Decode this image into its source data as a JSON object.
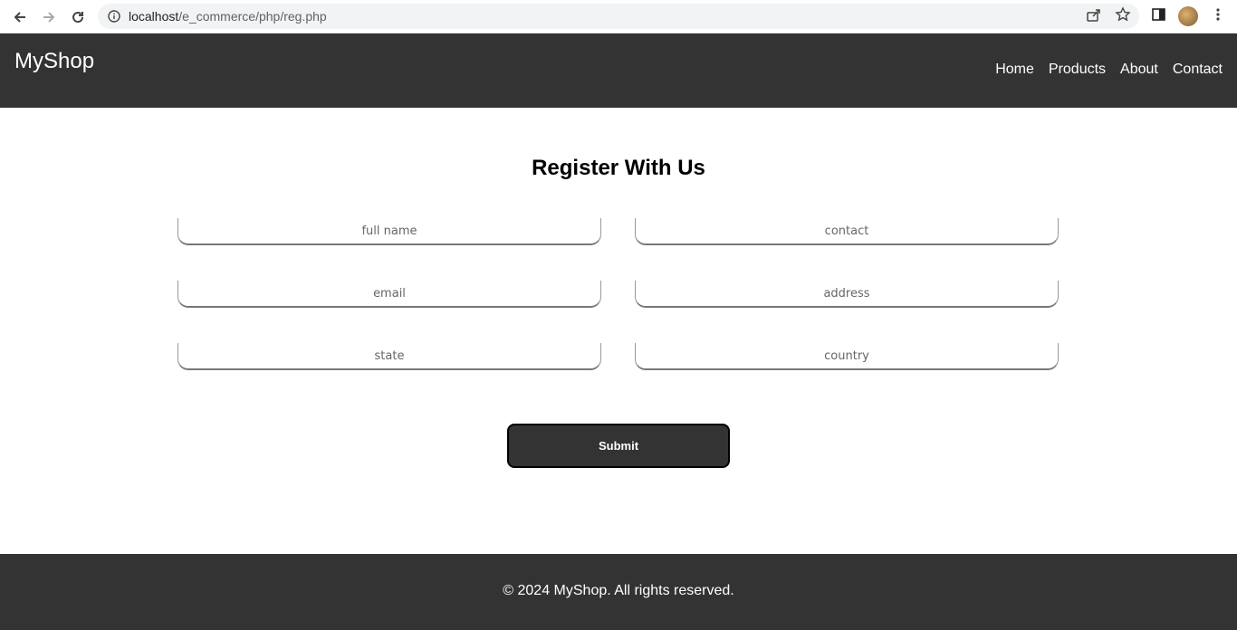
{
  "browser": {
    "url_host": "localhost",
    "url_path": "/e_commerce/php/reg.php"
  },
  "header": {
    "logo": "MyShop",
    "nav": [
      "Home",
      "Products",
      "About",
      "Contact"
    ]
  },
  "form": {
    "title": "Register With Us",
    "fields": {
      "full_name": "full name",
      "contact": "contact",
      "email": "email",
      "address": "address",
      "state": "state",
      "country": "country"
    },
    "submit": "Submit"
  },
  "footer": {
    "text": "© 2024 MyShop. All rights reserved."
  },
  "colors": {
    "header_bg": "#333333",
    "footer_bg": "#333333"
  }
}
